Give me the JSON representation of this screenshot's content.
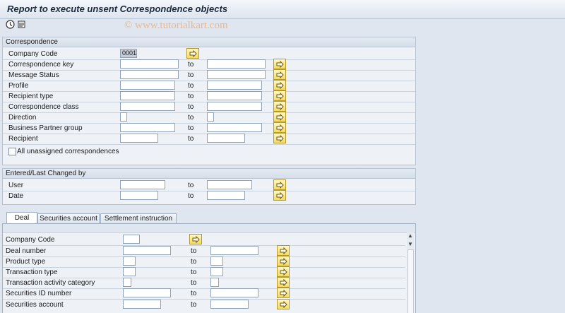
{
  "window": {
    "title": "Report to execute unsent Correspondence objects"
  },
  "watermark": "© www.tutorialkart.com",
  "toolbar": {
    "execute_icon": "execute-icon",
    "variant_icon": "get-variant-icon"
  },
  "correspondence": {
    "title": "Correspondence",
    "to_label": "to",
    "rows": [
      {
        "label": "Company Code",
        "value": "0001"
      },
      {
        "label": "Correspondence key"
      },
      {
        "label": "Message Status"
      },
      {
        "label": "Profile"
      },
      {
        "label": "Recipient type"
      },
      {
        "label": "Correspondence class"
      },
      {
        "label": "Direction"
      },
      {
        "label": "Business Partner group"
      },
      {
        "label": "Recipient"
      }
    ],
    "checkbox_label": "All unassigned correspondences"
  },
  "entered": {
    "title": "Entered/Last Changed by",
    "rows": [
      {
        "label": "User"
      },
      {
        "label": "Date"
      }
    ]
  },
  "tabs": [
    {
      "label": "Deal"
    },
    {
      "label": "Securities account"
    },
    {
      "label": "Settlement instruction"
    }
  ],
  "deal": {
    "rows": [
      {
        "label": "Company Code"
      },
      {
        "label": "Deal number"
      },
      {
        "label": "Product type"
      },
      {
        "label": "Transaction type"
      },
      {
        "label": "Transaction activity category"
      },
      {
        "label": "Securities ID number"
      },
      {
        "label": "Securities account"
      }
    ]
  }
}
